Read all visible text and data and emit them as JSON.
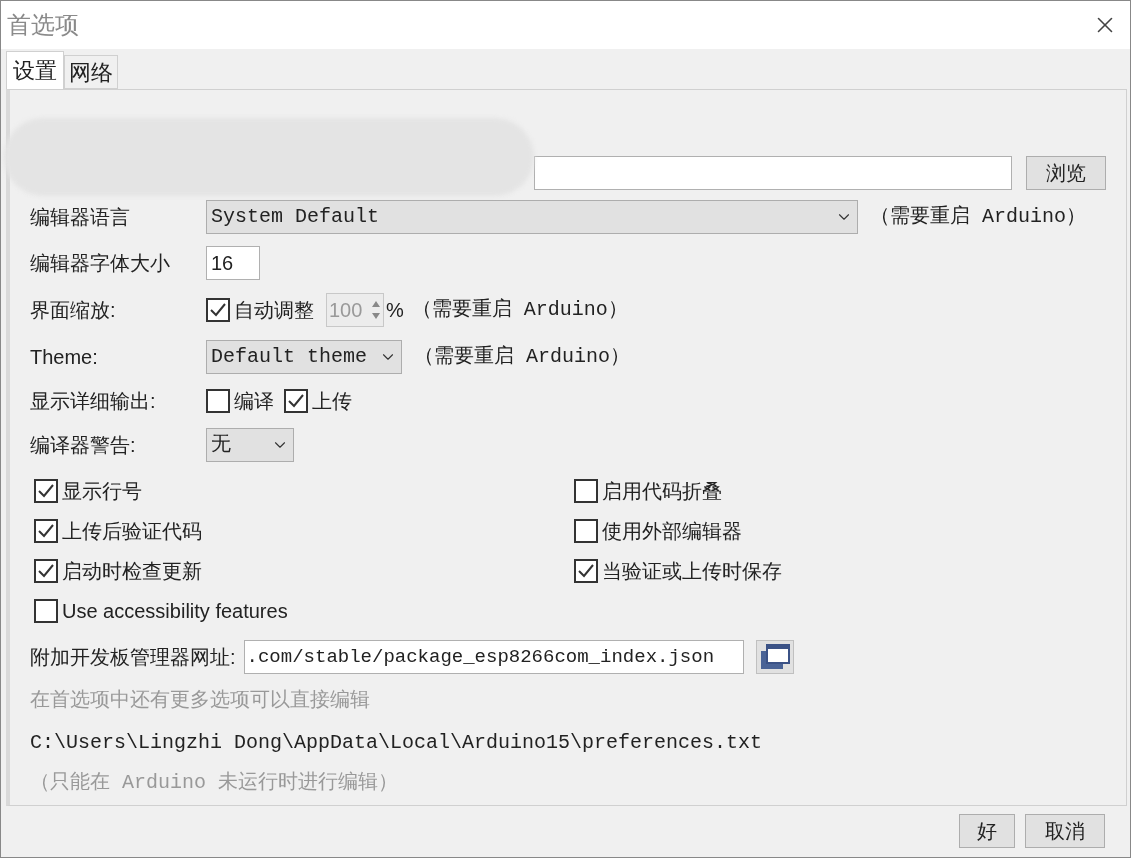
{
  "window": {
    "title": "首选项"
  },
  "tabs": [
    {
      "label": "设置",
      "selected": true
    },
    {
      "label": "网络",
      "selected": false
    }
  ],
  "sketchbook": {
    "browse_button": "浏览"
  },
  "editor_language": {
    "label": "编辑器语言",
    "value": "System Default",
    "note": "（需要重启 Arduino）"
  },
  "font_size": {
    "label": "编辑器字体大小",
    "value": "16"
  },
  "scale": {
    "label": "界面缩放:",
    "auto_label": "自动调整",
    "auto_checked": true,
    "value": "100",
    "unit": "%",
    "disabled": true,
    "note": "（需要重启 Arduino）"
  },
  "theme": {
    "label": "Theme:",
    "value": "Default theme",
    "note": "（需要重启 Arduino）"
  },
  "verbose": {
    "label": "显示详细输出:",
    "options": [
      {
        "label": "编译",
        "checked": false
      },
      {
        "label": "上传",
        "checked": true
      }
    ]
  },
  "warnings": {
    "label": "编译器警告:",
    "value": "无"
  },
  "options_left": [
    {
      "label": "显示行号",
      "checked": true
    },
    {
      "label": "上传后验证代码",
      "checked": true
    },
    {
      "label": "启动时检查更新",
      "checked": true
    },
    {
      "label": "Use accessibility features",
      "checked": false
    }
  ],
  "options_right": [
    {
      "label": "启用代码折叠",
      "checked": false
    },
    {
      "label": "使用外部编辑器",
      "checked": false
    },
    {
      "label": "当验证或上传时保存",
      "checked": true
    }
  ],
  "board_urls": {
    "label": "附加开发板管理器网址:",
    "value": ".com/stable/package_esp8266com_index.json"
  },
  "more_hint": "在首选项中还有更多选项可以直接编辑",
  "prefs_path": "C:\\Users\\Lingzhi Dong\\AppData\\Local\\Arduino15\\preferences.txt",
  "edit_note": "（只能在 Arduino 未运行时进行编辑）",
  "buttons": [
    "好",
    "取消"
  ]
}
